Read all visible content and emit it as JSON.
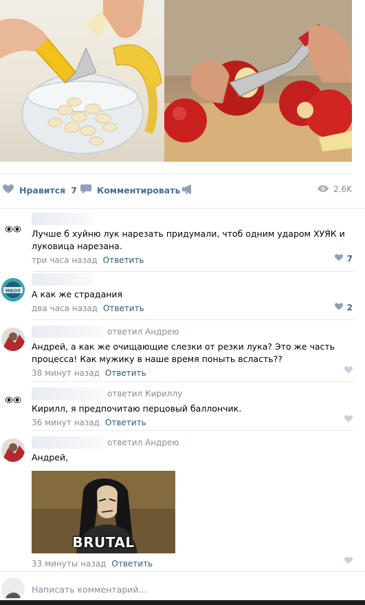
{
  "post": {
    "photos": [
      {
        "name": "banana-slicer-photo"
      },
      {
        "name": "apple-corer-photo"
      }
    ],
    "actions": {
      "like_label": "Нравится",
      "like_count": "7",
      "comment_label": "Комментировать",
      "views": "2.6K"
    }
  },
  "comments": [
    {
      "text": "Лучше б хуйню лук нарезать придумали, чтоб одним ударом ХУЯК и луковица нарезана.",
      "time": "три часа назад",
      "reply_label": "Ответить",
      "likes": "7"
    },
    {
      "text": "А как же страдания",
      "time": "два часа назад",
      "reply_label": "Ответить",
      "likes": "2",
      "avatar_text": "МБОУ"
    },
    {
      "replied_to": "ответил Андрею",
      "text": "Андрей, а как же очищающие слезки от резки лука? Это же часть процесса! Как мужику в наше время поныть всласть??",
      "time": "38 минут назад",
      "reply_label": "Ответить"
    },
    {
      "replied_to": "ответил Кириллу",
      "text": "Кирилл, я предпочитаю перцовый баллончик.",
      "time": "36 минут назад",
      "reply_label": "Ответить"
    },
    {
      "replied_to": "ответил Андрею",
      "text": "Андрей,",
      "image_caption": "BRUTAL",
      "time": "33 минуты назад",
      "reply_label": "Ответить"
    }
  ],
  "composer": {
    "placeholder": "Написать комментарий..."
  },
  "colors": {
    "link": "#2a5885",
    "action": "#4a6b92",
    "muted": "#818c99",
    "separator": "#e7e8ec"
  }
}
